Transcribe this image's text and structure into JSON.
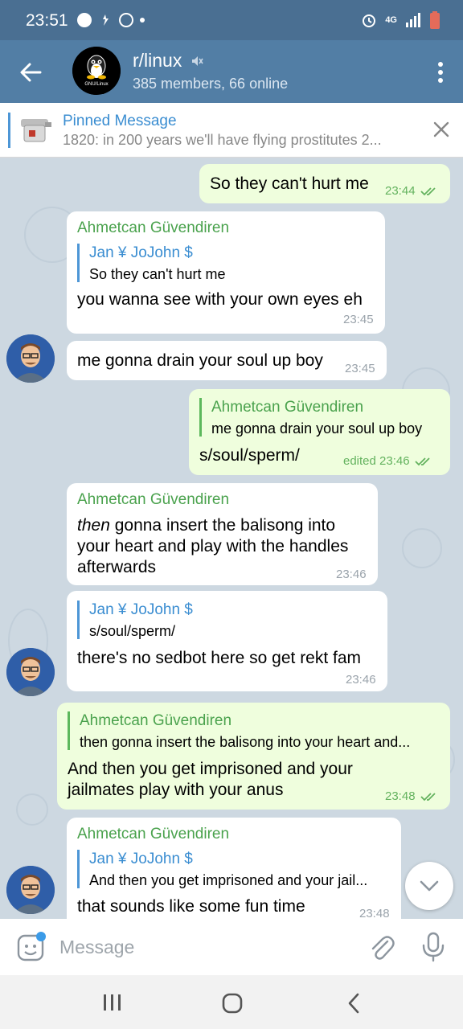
{
  "status_bar": {
    "time": "23:51",
    "network": "4G"
  },
  "header": {
    "title": "r/linux",
    "subtitle": "385 members, 66 online",
    "avatar_caption": "GNU/Linux"
  },
  "pinned": {
    "title": "Pinned Message",
    "text": "1820: in 200 years we'll have flying prostitutes  2..."
  },
  "messages": [
    {
      "text": "So they can't hurt me",
      "time": "23:44"
    },
    {
      "sender": "Ahmetcan Güvendiren",
      "quote_name": "Jan ¥ JoJohn $",
      "quote_text": "So they can't hurt me",
      "text": "you wanna see with your own eyes eh",
      "time": "23:45"
    },
    {
      "text": "me gonna drain your soul up boy",
      "time": "23:45"
    },
    {
      "quote_name": "Ahmetcan Güvendiren",
      "quote_text": "me gonna drain your soul up boy",
      "text": "s/soul/sperm/",
      "time": "edited 23:46"
    },
    {
      "sender": "Ahmetcan Güvendiren",
      "text_em": "then",
      "text_line1_rest": " gonna insert the balisong into",
      "text_line2": "your heart and play with the handles",
      "text_line3": "afterwards",
      "time": "23:46"
    },
    {
      "quote_name": "Jan ¥ JoJohn $",
      "quote_text": "s/soul/sperm/",
      "text": "there's no sedbot here so get rekt fam",
      "time": "23:46"
    },
    {
      "quote_name": "Ahmetcan Güvendiren",
      "quote_text": "then gonna insert the balisong into your heart and...",
      "text_line1": "And then you get imprisoned and your",
      "text_line2": "jailmates play with your anus",
      "time": "23:48"
    },
    {
      "sender": "Ahmetcan Güvendiren",
      "quote_name": "Jan ¥ JoJohn $",
      "quote_text": "And then you get imprisoned and your jail...",
      "text": "that sounds like some fun time",
      "time": "23:48"
    }
  ],
  "composer": {
    "placeholder": "Message"
  },
  "colors": {
    "header": "#527ea5",
    "status_bar": "#4a6f92",
    "outgoing_bubble": "#effedd",
    "incoming_bubble": "#ffffff",
    "sender_name": "#4aa24d",
    "reply_name": "#3a8dd1",
    "chat_background": "#cdd8e1"
  },
  "icons": [
    "back-arrow-icon",
    "mute-icon",
    "more-vert-icon",
    "pinned-thumbnail",
    "close-icon",
    "double-check-icon",
    "chevron-down-icon",
    "sticker-icon",
    "paperclip-icon",
    "microphone-icon",
    "recents-icon",
    "home-icon",
    "nav-back-icon"
  ]
}
